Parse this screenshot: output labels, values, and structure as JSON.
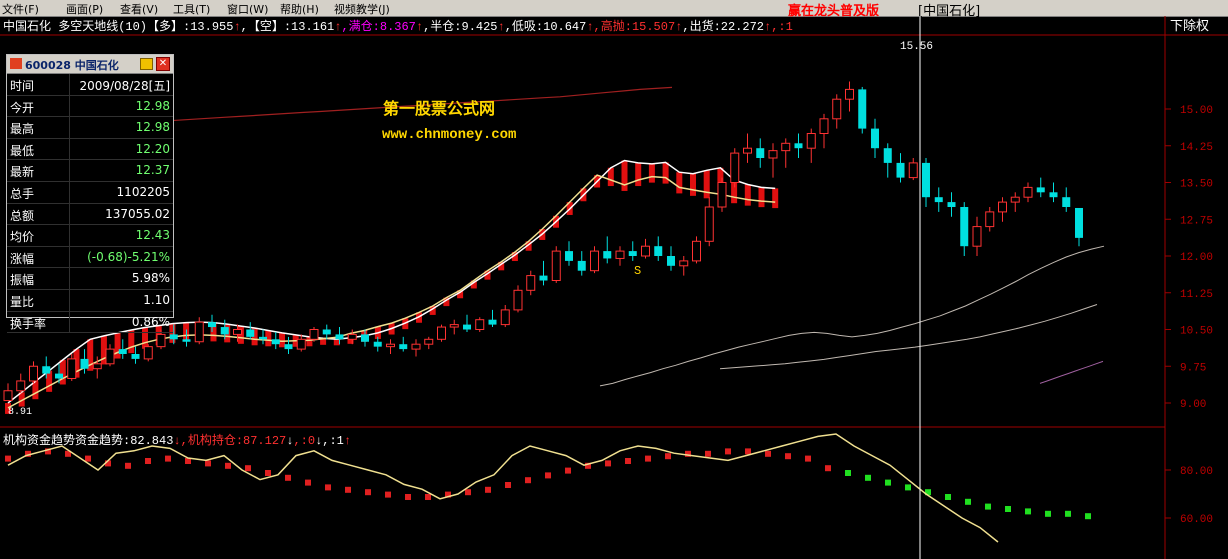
{
  "menu": {
    "items": [
      "文件(F)",
      "画面(P)",
      "查看(V)",
      "工具(T)",
      "窗口(W)",
      "帮助(H)",
      "视频教学(J)"
    ],
    "brand": "赢在龙头普及版",
    "brand_stock": "[中国石化]"
  },
  "indicator_top": {
    "stock_name": "中国石化",
    "indicator_name": "多空天地线(10)",
    "items": [
      {
        "label": "【多】:13.955",
        "color": "#ffffff"
      },
      {
        "label": "↑",
        "color": "#ff3030"
      },
      {
        "label": ",【空】:13.161",
        "color": "#ffffff"
      },
      {
        "label": "↑",
        "color": "#ff3030"
      },
      {
        "label": ",满仓:8.367",
        "color": "#ff00ff"
      },
      {
        "label": "↑",
        "color": "#ff3030"
      },
      {
        "label": ",半仓:9.425",
        "color": "#ffffff"
      },
      {
        "label": "↑",
        "color": "#ff3030"
      },
      {
        "label": ",低吸:10.647",
        "color": "#ffffff"
      },
      {
        "label": "↑",
        "color": "#ff3030"
      },
      {
        "label": ",高抛:15.507",
        "color": "#ff3030"
      },
      {
        "label": "↑",
        "color": "#ff3030"
      },
      {
        "label": ",出货:22.272",
        "color": "#ffffff"
      },
      {
        "label": "↑,:1",
        "color": "#ff3030"
      }
    ],
    "right_label": "下除权"
  },
  "indicator_bottom": {
    "items": [
      {
        "label": "机构资金趋势资金趋势:82.843",
        "color": "#ffffff"
      },
      {
        "label": "↓",
        "color": "#ff3030"
      },
      {
        "label": ",机构持仓:87.127",
        "color": "#ff3030"
      },
      {
        "label": "↓",
        "color": "#ffffff"
      },
      {
        "label": ",:0",
        "color": "#ff3030"
      },
      {
        "label": "↓",
        "color": "#ffffff"
      },
      {
        "label": ",:1",
        "color": "#ffffff"
      },
      {
        "label": "↑",
        "color": "#ff3030"
      }
    ]
  },
  "watermark": {
    "line1": "第一股票公式网",
    "line2": "www.chnmoney.com"
  },
  "peak_label": "15.56",
  "signal_label": "S",
  "low_label": "8.91",
  "price_axis_labels": [
    "15.00",
    "14.25",
    "13.50",
    "12.75",
    "12.00",
    "11.25",
    "10.50",
    "9.75",
    "9.00"
  ],
  "lower_axis_labels": [
    "80.00",
    "60.00"
  ],
  "floating_window": {
    "title": "600028 中国石化",
    "rows": [
      {
        "label": "时间",
        "value": "2009/08/28[五]",
        "color": "#ffffff"
      },
      {
        "label": "今开",
        "value": "12.98",
        "color": "#70ff70"
      },
      {
        "label": "最高",
        "value": "12.98",
        "color": "#70ff70"
      },
      {
        "label": "最低",
        "value": "12.20",
        "color": "#70ff70"
      },
      {
        "label": "最新",
        "value": "12.37",
        "color": "#70ff70"
      },
      {
        "label": "总手",
        "value": "1102205",
        "color": "#ffffff"
      },
      {
        "label": "总额",
        "value": "137055.02",
        "color": "#ffffff"
      },
      {
        "label": "均价",
        "value": "12.43",
        "color": "#70ff70"
      },
      {
        "label": "涨幅",
        "value": "(-0.68)-5.21%",
        "color": "#70ff70"
      },
      {
        "label": "振幅",
        "value": "5.98%",
        "color": "#ffffff"
      },
      {
        "label": "量比",
        "value": "1.10",
        "color": "#ffffff"
      },
      {
        "label": "换手率",
        "value": "0.86%",
        "color": "#ffffff"
      }
    ]
  },
  "chart_data": {
    "type": "candlestick",
    "price_axis": {
      "min": 8.85,
      "max": 15.6,
      "ticks": [
        9.0,
        9.75,
        10.5,
        11.25,
        12.0,
        12.75,
        13.5,
        14.25,
        15.0
      ]
    },
    "lower_axis": {
      "min": 45,
      "max": 100,
      "ticks": [
        60,
        80
      ]
    },
    "up_color": "#ff3232",
    "down_color": "#00e0e0",
    "candles": [
      [
        9.05,
        9.4,
        9.1,
        9.25
      ],
      [
        9.25,
        9.6,
        9.2,
        9.45
      ],
      [
        9.45,
        9.85,
        9.4,
        9.75
      ],
      [
        9.75,
        9.95,
        9.5,
        9.6
      ],
      [
        9.6,
        9.8,
        9.4,
        9.5
      ],
      [
        9.5,
        10.0,
        9.45,
        9.9
      ],
      [
        9.9,
        10.1,
        9.6,
        9.7
      ],
      [
        9.7,
        9.95,
        9.5,
        9.8
      ],
      [
        9.8,
        10.2,
        9.75,
        10.1
      ],
      [
        10.1,
        10.3,
        9.9,
        10.0
      ],
      [
        10.0,
        10.15,
        9.8,
        9.9
      ],
      [
        9.9,
        10.2,
        9.85,
        10.15
      ],
      [
        10.15,
        10.5,
        10.1,
        10.4
      ],
      [
        10.4,
        10.6,
        10.2,
        10.3
      ],
      [
        10.3,
        10.5,
        10.15,
        10.25
      ],
      [
        10.25,
        10.75,
        10.2,
        10.65
      ],
      [
        10.65,
        10.8,
        10.45,
        10.55
      ],
      [
        10.55,
        10.7,
        10.3,
        10.4
      ],
      [
        10.4,
        10.6,
        10.25,
        10.5
      ],
      [
        10.5,
        10.65,
        10.3,
        10.35
      ],
      [
        10.35,
        10.5,
        10.2,
        10.3
      ],
      [
        10.3,
        10.45,
        10.1,
        10.2
      ],
      [
        10.2,
        10.35,
        10.0,
        10.1
      ],
      [
        10.1,
        10.4,
        10.05,
        10.3
      ],
      [
        10.3,
        10.55,
        10.25,
        10.5
      ],
      [
        10.5,
        10.6,
        10.3,
        10.4
      ],
      [
        10.4,
        10.55,
        10.2,
        10.3
      ],
      [
        10.3,
        10.5,
        10.2,
        10.4
      ],
      [
        10.4,
        10.5,
        10.15,
        10.25
      ],
      [
        10.25,
        10.35,
        10.05,
        10.15
      ],
      [
        10.15,
        10.3,
        10.0,
        10.2
      ],
      [
        10.2,
        10.35,
        10.05,
        10.1
      ],
      [
        10.1,
        10.3,
        9.95,
        10.2
      ],
      [
        10.2,
        10.35,
        10.1,
        10.3
      ],
      [
        10.3,
        10.6,
        10.25,
        10.55
      ],
      [
        10.55,
        10.7,
        10.4,
        10.6
      ],
      [
        10.6,
        10.8,
        10.45,
        10.5
      ],
      [
        10.5,
        10.75,
        10.45,
        10.7
      ],
      [
        10.7,
        10.9,
        10.55,
        10.6
      ],
      [
        10.6,
        11.0,
        10.55,
        10.9
      ],
      [
        10.9,
        11.4,
        10.85,
        11.3
      ],
      [
        11.3,
        11.7,
        11.2,
        11.6
      ],
      [
        11.6,
        11.9,
        11.4,
        11.5
      ],
      [
        11.5,
        12.2,
        11.45,
        12.1
      ],
      [
        12.1,
        12.3,
        11.8,
        11.9
      ],
      [
        11.9,
        12.1,
        11.6,
        11.7
      ],
      [
        11.7,
        12.2,
        11.65,
        12.1
      ],
      [
        12.1,
        12.4,
        11.85,
        11.95
      ],
      [
        11.95,
        12.2,
        11.8,
        12.1
      ],
      [
        12.1,
        12.3,
        11.9,
        12.0
      ],
      [
        12.0,
        12.35,
        11.95,
        12.2
      ],
      [
        12.2,
        12.4,
        11.9,
        12.0
      ],
      [
        12.0,
        12.2,
        11.7,
        11.8
      ],
      [
        11.8,
        12.0,
        11.6,
        11.9
      ],
      [
        11.9,
        12.4,
        11.85,
        12.3
      ],
      [
        12.3,
        13.2,
        12.2,
        13.0
      ],
      [
        13.0,
        13.6,
        12.9,
        13.5
      ],
      [
        13.5,
        14.2,
        13.4,
        14.1
      ],
      [
        14.1,
        14.5,
        13.9,
        14.2
      ],
      [
        14.2,
        14.4,
        13.8,
        14.0
      ],
      [
        14.0,
        14.3,
        13.6,
        14.15
      ],
      [
        14.15,
        14.4,
        13.8,
        14.3
      ],
      [
        14.3,
        14.5,
        14.0,
        14.2
      ],
      [
        14.2,
        14.6,
        13.9,
        14.5
      ],
      [
        14.5,
        14.9,
        14.2,
        14.8
      ],
      [
        14.8,
        15.3,
        14.6,
        15.2
      ],
      [
        15.2,
        15.56,
        14.95,
        15.4
      ],
      [
        15.4,
        15.45,
        14.5,
        14.6
      ],
      [
        14.6,
        14.8,
        14.0,
        14.2
      ],
      [
        14.2,
        14.3,
        13.6,
        13.9
      ],
      [
        13.9,
        14.1,
        13.5,
        13.6
      ],
      [
        13.6,
        14.0,
        13.55,
        13.9
      ],
      [
        13.9,
        14.0,
        13.0,
        13.2
      ],
      [
        13.2,
        13.4,
        12.9,
        13.1
      ],
      [
        13.1,
        13.3,
        12.8,
        13.0
      ],
      [
        13.0,
        13.1,
        12.0,
        12.2
      ],
      [
        12.2,
        12.8,
        12.0,
        12.6
      ],
      [
        12.6,
        13.0,
        12.5,
        12.9
      ],
      [
        12.9,
        13.2,
        12.7,
        13.1
      ],
      [
        13.1,
        13.3,
        12.9,
        13.2
      ],
      [
        13.2,
        13.5,
        13.1,
        13.4
      ],
      [
        13.4,
        13.6,
        13.2,
        13.3
      ],
      [
        13.3,
        13.5,
        13.1,
        13.2
      ],
      [
        13.2,
        13.4,
        12.9,
        13.0
      ],
      [
        12.98,
        12.98,
        12.2,
        12.37
      ]
    ],
    "upper_band_line": [
      9.0,
      9.22,
      9.44,
      9.66,
      9.88,
      10.1,
      10.3,
      10.37,
      10.43,
      10.49,
      10.54,
      10.58,
      10.62,
      10.64,
      10.65,
      10.64,
      10.61,
      10.57,
      10.53,
      10.48,
      10.43,
      10.39,
      10.35,
      10.32,
      10.3,
      10.33,
      10.37,
      10.43,
      10.52,
      10.63,
      10.76,
      10.92,
      11.1,
      11.26,
      11.46,
      11.64,
      11.83,
      12.02,
      12.23,
      12.45,
      12.7,
      12.96,
      13.24,
      13.52,
      13.8,
      13.95,
      13.9,
      13.88,
      13.91,
      13.71,
      13.68,
      13.75,
      13.8,
      13.55,
      13.46,
      13.4,
      13.38
    ],
    "lower_band_line": [
      8.9,
      9.05,
      9.2,
      9.35,
      9.5,
      9.64,
      9.78,
      9.91,
      10.03,
      10.14,
      10.23,
      10.3,
      10.35,
      10.38,
      10.39,
      10.38,
      10.36,
      10.33,
      10.3,
      10.28,
      10.26,
      10.27,
      10.28,
      10.31,
      10.34,
      10.42,
      10.48,
      10.56,
      10.63,
      10.73,
      10.85,
      10.98,
      11.15,
      11.3,
      11.5,
      11.7,
      11.88,
      12.08,
      12.3,
      12.55,
      12.82,
      13.1,
      13.38,
      13.65,
      13.55,
      13.45,
      13.55,
      13.62,
      13.6,
      13.4,
      13.35,
      13.3,
      13.26,
      13.2,
      13.15,
      13.12,
      13.1
    ],
    "mid_line_1": [
      9.35,
      9.4,
      9.48,
      9.55,
      9.62,
      9.7,
      9.77,
      9.85,
      9.92,
      10.0,
      10.07,
      10.14,
      10.2,
      10.26,
      10.32,
      10.38,
      10.42,
      10.44,
      10.42,
      10.38,
      10.35,
      10.38,
      10.42,
      10.48,
      10.55,
      10.62,
      10.7,
      10.78,
      10.88,
      10.98,
      11.1,
      11.22,
      11.35,
      11.48,
      11.62,
      11.75,
      11.87,
      11.98,
      12.07,
      12.14,
      12.2
    ],
    "mid_line_2": [
      9.7,
      9.72,
      9.74,
      9.76,
      9.78,
      9.8,
      9.83,
      9.86,
      9.89,
      9.93,
      9.97,
      10.01,
      10.05,
      10.08,
      10.11,
      10.14,
      10.18,
      10.22,
      10.26,
      10.3,
      10.35,
      10.41,
      10.47,
      10.53,
      10.6,
      10.67,
      10.75,
      10.83,
      10.92,
      11.01
    ],
    "mid_line_3": [
      9.4,
      9.45,
      9.5,
      9.55,
      9.6,
      9.65,
      9.7,
      9.75,
      9.8,
      9.85
    ],
    "red_line": [
      14.75,
      14.77,
      14.79,
      14.81,
      14.83,
      14.85,
      14.87,
      14.89,
      14.91,
      14.93,
      14.95,
      14.97,
      14.99,
      15.01,
      15.03,
      15.05,
      15.07,
      15.09,
      15.11,
      15.13,
      15.15,
      15.17,
      15.19,
      15.21,
      15.23,
      15.25,
      15.28,
      15.31,
      15.34,
      15.37,
      15.4,
      15.42,
      15.44
    ],
    "lower_fund_line": [
      82,
      86,
      88,
      90,
      85,
      80,
      87,
      88,
      90,
      89,
      85,
      84,
      86,
      80,
      76,
      78,
      86,
      88,
      84,
      82,
      80,
      78,
      74,
      72,
      68,
      70,
      75,
      78,
      86,
      90,
      88,
      86,
      82,
      84,
      88,
      90,
      89,
      87,
      86,
      85,
      84,
      86,
      88,
      90,
      92,
      94,
      95,
      90,
      86,
      82,
      76,
      70,
      65,
      60,
      56,
      50
    ],
    "lower_hold_bars": [
      86,
      88,
      89,
      88,
      86,
      84,
      83,
      85,
      86,
      85,
      84,
      83,
      82,
      80,
      78,
      76,
      74,
      73,
      72,
      71,
      70,
      70,
      71,
      72,
      73,
      75,
      77,
      79,
      81,
      83,
      84,
      85,
      86,
      87,
      88,
      88,
      89,
      89,
      88,
      87,
      86,
      82,
      80,
      78,
      76,
      74,
      72,
      70,
      68,
      66,
      65,
      64,
      63,
      63,
      62
    ]
  }
}
